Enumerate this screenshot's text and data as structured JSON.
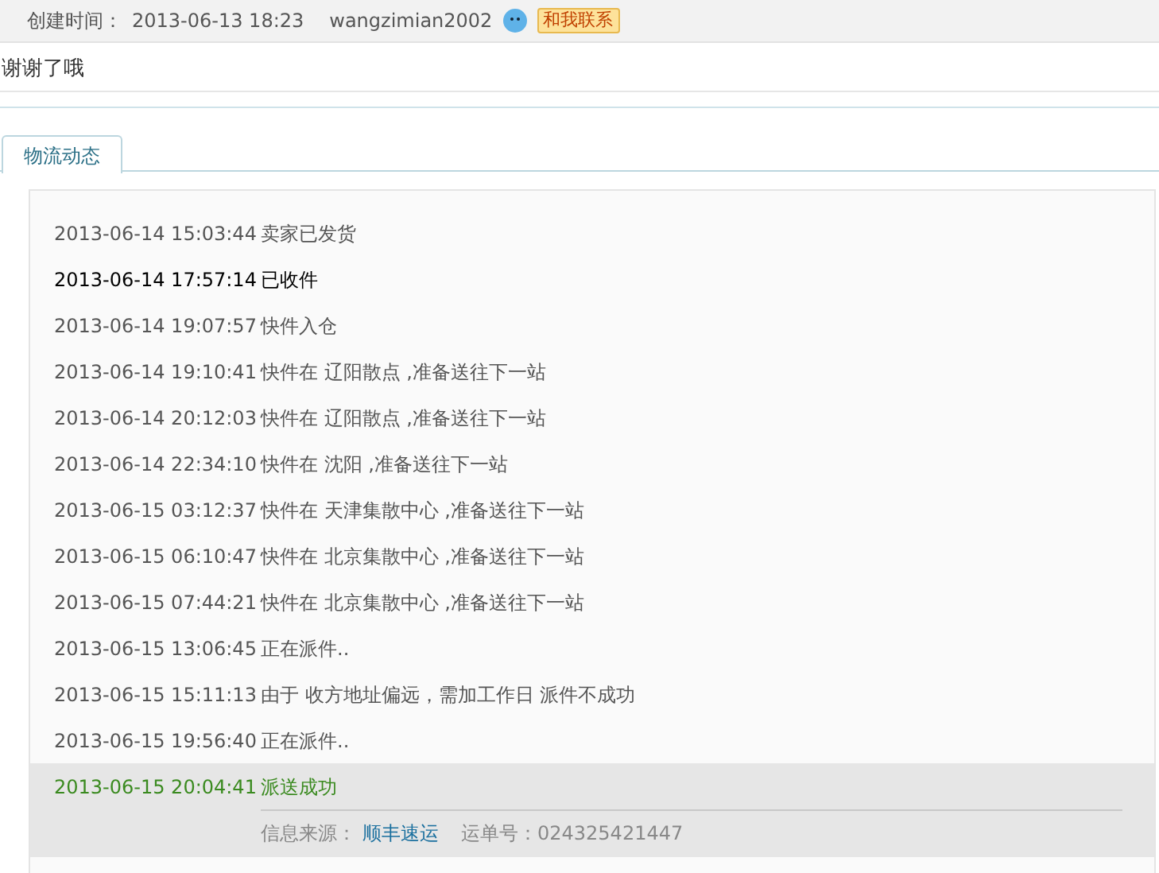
{
  "header": {
    "created_label": "创建时间：",
    "created_time": "2013-06-13 18:23",
    "user": "wangzimian2002",
    "contact_button": "和我联系"
  },
  "message": "谢谢了哦",
  "tabs": [
    {
      "label": "物流动态",
      "selected": true
    }
  ],
  "events": [
    {
      "time": "2013-06-14 15:03:44",
      "text": "卖家已发货",
      "kind": "normal"
    },
    {
      "time": "2013-06-14 17:57:14",
      "text": "已收件",
      "kind": "emphasis"
    },
    {
      "time": "2013-06-14 19:07:57",
      "text": "快件入仓",
      "kind": "normal"
    },
    {
      "time": "2013-06-14 19:10:41",
      "text": "快件在 辽阳散点 ,准备送往下一站",
      "kind": "normal"
    },
    {
      "time": "2013-06-14 20:12:03",
      "text": "快件在 辽阳散点 ,准备送往下一站",
      "kind": "normal"
    },
    {
      "time": "2013-06-14 22:34:10",
      "text": "快件在 沈阳 ,准备送往下一站",
      "kind": "normal"
    },
    {
      "time": "2013-06-15 03:12:37",
      "text": "快件在 天津集散中心 ,准备送往下一站",
      "kind": "normal"
    },
    {
      "time": "2013-06-15 06:10:47",
      "text": "快件在 北京集散中心 ,准备送往下一站",
      "kind": "normal"
    },
    {
      "time": "2013-06-15 07:44:21",
      "text": "快件在 北京集散中心 ,准备送往下一站",
      "kind": "normal"
    },
    {
      "time": "2013-06-15 13:06:45",
      "text": "正在派件..",
      "kind": "normal"
    },
    {
      "time": "2013-06-15 15:11:13",
      "text": "由于 收方地址偏远，需加工作日 派件不成功",
      "kind": "normal"
    },
    {
      "time": "2013-06-15 19:56:40",
      "text": "正在派件..",
      "kind": "normal"
    },
    {
      "time": "2013-06-15 20:04:41",
      "text": "派送成功",
      "kind": "latest"
    }
  ],
  "footer": {
    "source_label": "信息来源：",
    "carrier": "顺丰速运",
    "waybill": "运单号：024325421447"
  }
}
